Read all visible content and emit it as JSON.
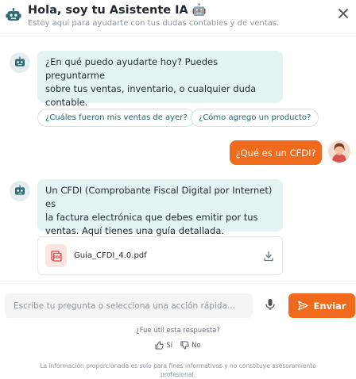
{
  "header": {
    "title": "Hola, soy tu Asistente IA 🤖",
    "subtitle": "Estoy aquí para ayudarte con tus dudas contables y de ventas."
  },
  "messages": {
    "bot_1": {
      "line_1": "¿En qué puedo ayudarte hoy? Puedes preguntarme",
      "line_2": "sobre tus ventas, inventario, o cualquier duda",
      "line_3": "contable."
    },
    "quick_actions": [
      {
        "label": "¿Cuáles fueron mis ventas de ayer?"
      },
      {
        "label": "¿Cómo agrego un producto?"
      }
    ],
    "user_1": "¿Qué es un CFDI?",
    "bot_2": {
      "line_1": "Un CFDI (Comprobante Fiscal Digital por Internet) es",
      "line_2": "la factura electrónica que debes emitir por tus",
      "line_3": "ventas. Aquí tienes una guía detallada."
    },
    "attachment": {
      "filename": "Guia_CFDI_4.0.pdf"
    }
  },
  "composer": {
    "placeholder": "Escribe tu pregunta o selecciona una acción rápida...",
    "value": "",
    "send_label": "Enviar"
  },
  "feedback": {
    "question": "¿Fue útil esta respuesta?",
    "yes_label": "Sí",
    "no_label": "No"
  },
  "disclaimer": {
    "line_1": "La información proporcionada es solo para fines informativos y no constituye asesoramiento",
    "line_2": "profesional."
  },
  "colors": {
    "accent": "#f06a1e",
    "bot_bubble": "#e4f3f3",
    "teal_text": "#23646a"
  },
  "icons": {
    "header": "robot-icon",
    "close": "close-icon",
    "attachment": "pdf-icon",
    "download": "download-icon",
    "mic": "microphone-icon",
    "send": "send-icon",
    "yes": "thumbs-up-icon",
    "no": "thumbs-down-icon"
  }
}
